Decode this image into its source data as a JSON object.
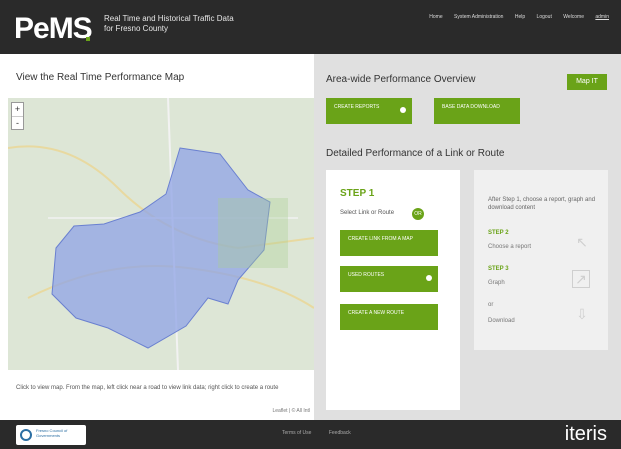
{
  "header": {
    "logo": "PeMS",
    "subtitle_line1": "Real Time and Historical Traffic Data",
    "subtitle_line2": "for Fresno County",
    "nav": [
      "Home",
      "System Administration",
      "Help",
      "Logout"
    ],
    "welcome": "Welcome",
    "user": "admin"
  },
  "map": {
    "title": "View the Real Time Performance Map",
    "zoom_in": "+",
    "zoom_out": "-",
    "caption": "Click to view map. From the map, left click near a road to view link data; right click to create a route",
    "attribution": "Leaflet | © All Intl"
  },
  "overview": {
    "title": "Area-wide Performance Overview",
    "map_button": "Map IT",
    "buttons": [
      {
        "label": "CREATE REPORTS"
      },
      {
        "label": "BASE DATA DOWNLOAD"
      }
    ]
  },
  "detailed": {
    "title": "Detailed Performance of a Link or Route",
    "step1": "STEP 1",
    "select_text": "Select Link or Route",
    "or_label": "OR",
    "buttons": [
      {
        "label": "CREATE LINK FROM A MAP"
      },
      {
        "label": "USED ROUTES"
      },
      {
        "label": "CREATE A NEW ROUTE"
      }
    ],
    "after_text": "After Step 1, choose a report, graph and download content",
    "step2": "STEP 2",
    "step2_sub": "Choose a report",
    "step3": "STEP 3",
    "step3_sub": "Graph",
    "or_text": "or",
    "download": "Download"
  },
  "footer": {
    "org_name": "Fresno Council of Governments",
    "links": [
      "Terms of Use",
      "Feedback"
    ],
    "brand": "iteris"
  },
  "colors": {
    "accent_green": "#6aa318",
    "map_overlay": "#8fa3e6",
    "dark_bar": "#2a2a2a"
  }
}
